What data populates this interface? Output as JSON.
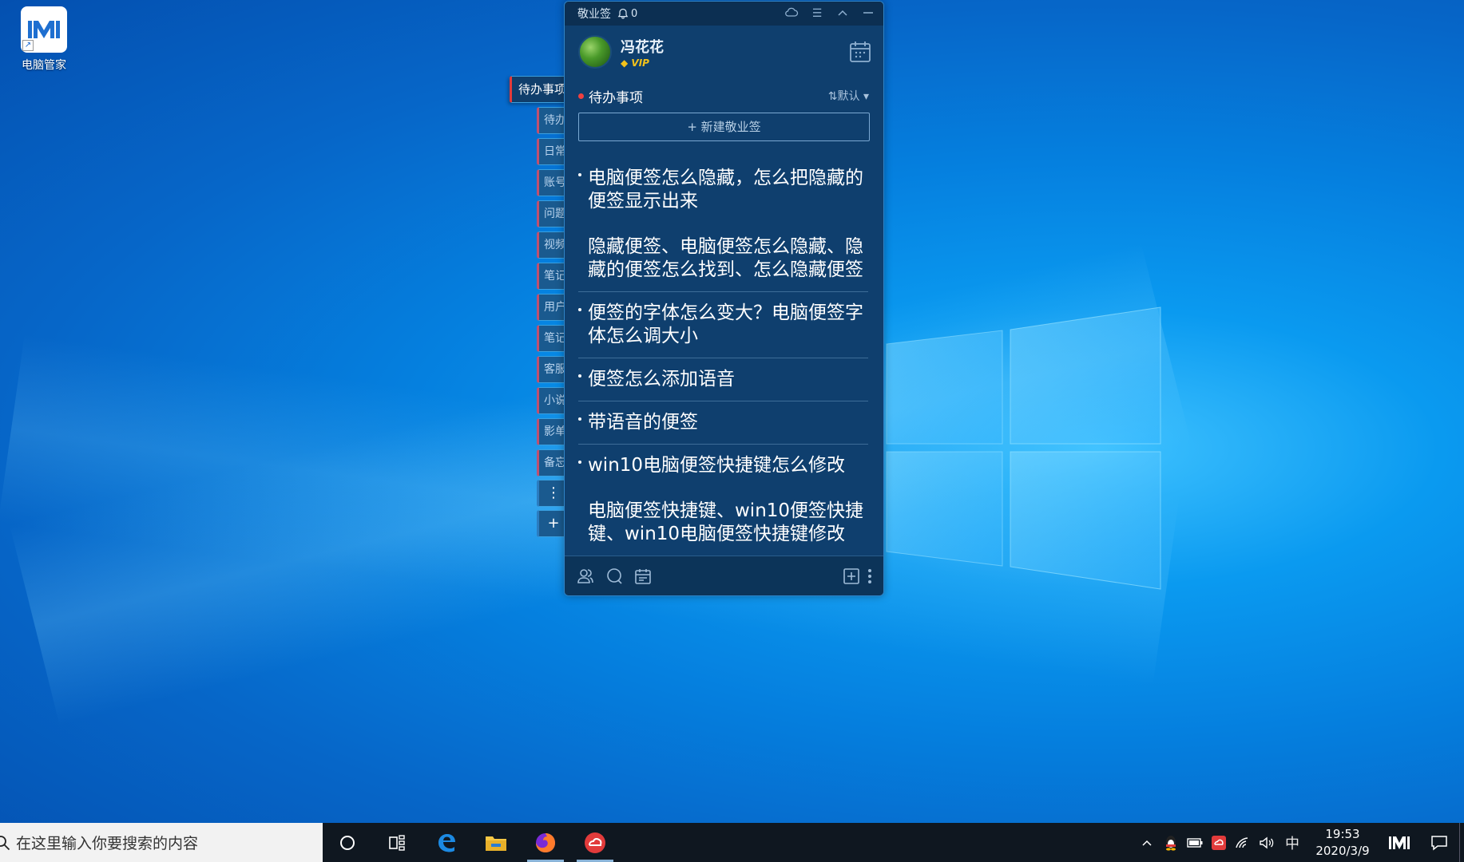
{
  "desktop": {
    "icon_label": "电脑管家"
  },
  "categories": {
    "active": "待办事项",
    "tabs": [
      "待办",
      "日常",
      "账号",
      "问题",
      "视频",
      "笔记",
      "用户",
      "笔记",
      "客服",
      "小说",
      "影单",
      "备忘"
    ],
    "more_label": "⋮",
    "add_label": "+"
  },
  "note": {
    "app_title": "敬业签",
    "reminder_count": "0",
    "user_name": "冯花花",
    "vip_label": "VIP",
    "list_title": "待办事项",
    "sort_label": "⇅默认",
    "new_button": "+ 新建敬业签",
    "items": [
      {
        "title": "电脑便签怎么隐藏，怎么把隐藏的便签显示出来",
        "detail": "隐藏便签、电脑便签怎么隐藏、隐藏的便签怎么找到、怎么隐藏便签"
      },
      {
        "title": "便签的字体怎么变大？电脑便签字体怎么调大小",
        "detail": ""
      },
      {
        "title": "便签怎么添加语音",
        "detail": ""
      },
      {
        "title": "带语音的便签",
        "detail": ""
      },
      {
        "title": "win10电脑便签快捷键怎么修改",
        "detail": "电脑便签快捷键、win10便签快捷键、win10电脑便签快捷键修改"
      }
    ]
  },
  "taskbar": {
    "search_placeholder": "在这里输入你要搜索的内容",
    "ime_label": "中",
    "time": "19:53",
    "date": "2020/3/9"
  },
  "colors": {
    "note_bg": "#0f3f6e",
    "accent_red": "#f04040",
    "vip_gold": "#f3c21b"
  }
}
